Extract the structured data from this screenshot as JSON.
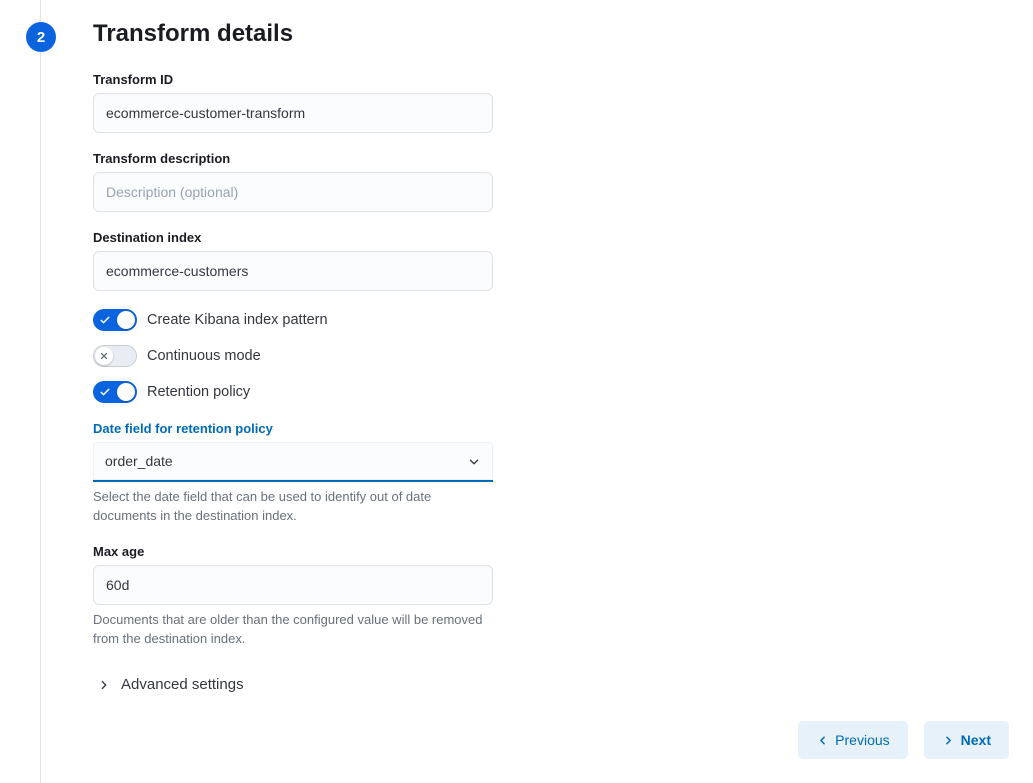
{
  "step": {
    "number": "2",
    "title": "Transform details"
  },
  "form": {
    "transform_id": {
      "label": "Transform ID",
      "value": "ecommerce-customer-transform"
    },
    "transform_description": {
      "label": "Transform description",
      "placeholder": "Description (optional)",
      "value": ""
    },
    "destination_index": {
      "label": "Destination index",
      "value": "ecommerce-customers"
    },
    "switches": {
      "create_index_pattern": {
        "label": "Create Kibana index pattern",
        "value": true
      },
      "continuous_mode": {
        "label": "Continuous mode",
        "value": false
      },
      "retention_policy": {
        "label": "Retention policy",
        "value": true
      }
    },
    "retention_date_field": {
      "label": "Date field for retention policy",
      "value": "order_date",
      "help": "Select the date field that can be used to identify out of date documents in the destination index."
    },
    "max_age": {
      "label": "Max age",
      "value": "60d",
      "help": "Documents that are older than the configured value will be removed from the destination index."
    },
    "advanced_settings": "Advanced settings"
  },
  "buttons": {
    "previous": "Previous",
    "next": "Next"
  }
}
